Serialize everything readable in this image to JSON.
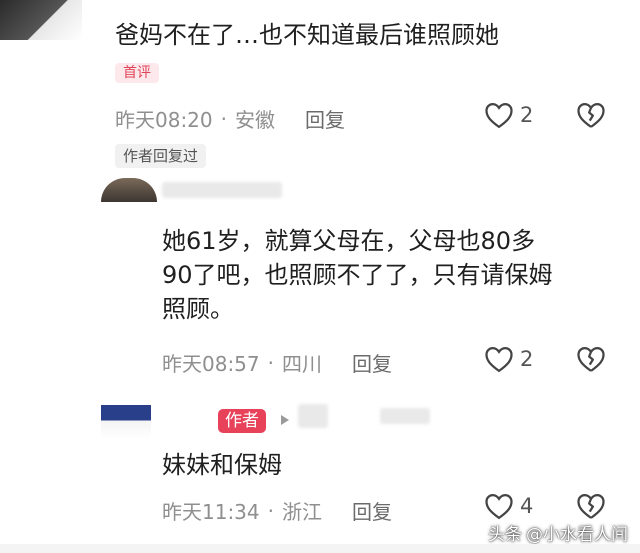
{
  "comment1": {
    "text": "爸妈不在了…也不知道最后谁照顾她",
    "badge": "首评",
    "time": "昨天08:20",
    "separator": "·",
    "location": "安徽",
    "reply_label": "回复",
    "like_count": "2",
    "author_replied_badge": "作者回复过"
  },
  "comment2": {
    "text_lines": [
      "她61岁，就算父母在，父母也80多",
      "90了吧，也照顾不了了，只有请保姆",
      "照顾。"
    ],
    "time": "昨天08:57",
    "separator": "·",
    "location": "四川",
    "reply_label": "回复",
    "like_count": "2"
  },
  "comment3": {
    "author_badge": "作者",
    "text": "妹妹和保姆",
    "time": "昨天11:34",
    "separator": "·",
    "location": "浙江",
    "reply_label": "回复",
    "like_count": "4"
  },
  "watermark": {
    "prefix": "头条",
    "text": "@小水看人间"
  },
  "icons": {
    "like": "heart-outline-icon",
    "dislike": "broken-heart-icon",
    "reply_arrow": "small-triangle-icon"
  },
  "colors": {
    "accent": "#e8425a",
    "meta_gray": "#8f8f8f"
  }
}
